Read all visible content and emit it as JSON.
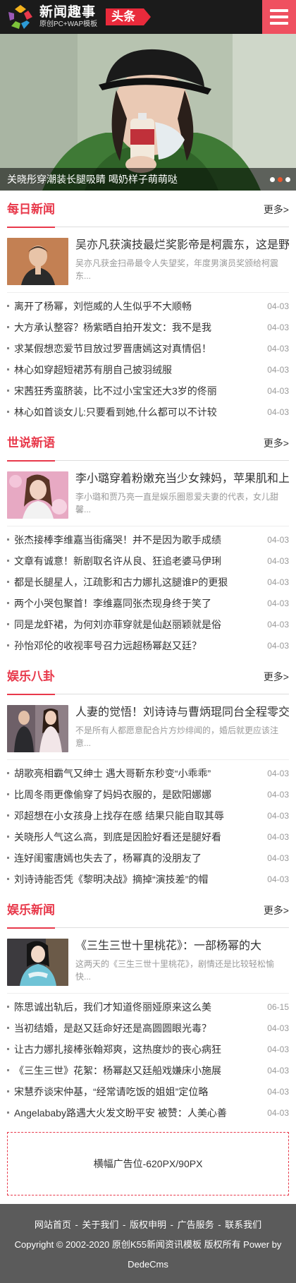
{
  "header": {
    "logo_title": "新闻趣事",
    "logo_sub": "原创PC+WAP模板",
    "badge": "头条"
  },
  "banner": {
    "caption": "关晓彤穿潮装长腿吸睛 喝奶样子萌萌哒",
    "slide_count": 3,
    "active_slide": 1
  },
  "sections": [
    {
      "title": "每日新闻",
      "more": "更多>",
      "feature": {
        "title": "吴亦凡获演技最烂奖影帝是柯震东，这是野",
        "desc": "吴亦凡获金扫帚最令人失望奖，年度男演员奖颁给柯震东..."
      },
      "items": [
        {
          "title": "离开了杨幂，刘恺威的人生似乎不大顺畅",
          "date": "04-03"
        },
        {
          "title": "大方承认整容？杨紫晒自拍开发文：我不是我",
          "date": "04-03"
        },
        {
          "title": "求某假想恋爱节目放过罗晋唐嫣这对真情侣！",
          "date": "04-03"
        },
        {
          "title": "林心如穿超短裙苏有朋自己披羽绒服",
          "date": "04-03"
        },
        {
          "title": "宋茜狂秀蛮脐装，比不过小宝宝还大3岁的佟丽",
          "date": "04-03"
        },
        {
          "title": "林心如首谈女儿:只要看到她,什么都可以不计较",
          "date": "04-03"
        }
      ]
    },
    {
      "title": "世说新语",
      "more": "更多>",
      "feature": {
        "title": "李小璐穿着粉嫩充当少女辣妈，苹果肌和上",
        "desc": "李小璐和贾乃亮一直是娱乐圈恩爱夫妻的代表，女儿甜馨..."
      },
      "items": [
        {
          "title": "张杰接棒李维嘉当街痛哭！并不是因为歌手成绩",
          "date": "04-03"
        },
        {
          "title": "文章有诚意！新剧取名许从良、狂追老婆马伊琍",
          "date": "04-03"
        },
        {
          "title": "都是长腿星人，江疏影和古力娜扎这腿谁P的更狠",
          "date": "04-03"
        },
        {
          "title": "两个小哭包聚首！李维嘉同张杰现身终于笑了",
          "date": "04-03"
        },
        {
          "title": "同是龙虾裙，为何刘亦菲穿就是仙赵丽颖就是俗",
          "date": "04-03"
        },
        {
          "title": "孙怡邓伦的收视率号召力远超杨幂赵又廷？",
          "date": "04-03"
        }
      ]
    },
    {
      "title": "娱乐八卦",
      "more": "更多>",
      "feature": {
        "title": "人妻的觉悟！刘诗诗与曹炳琨同台全程零交",
        "desc": "不是所有人都愿意配合片方炒绯闻的，婚后就更应该注意..."
      },
      "items": [
        {
          "title": "胡歌亮相霸气又绅士 遇大哥靳东秒变“小乖乖”",
          "date": "04-03"
        },
        {
          "title": "比周冬雨更像偷穿了妈妈衣服的，是欧阳娜娜",
          "date": "04-03"
        },
        {
          "title": "邓超想在小女孩身上找存在感 结果只能自取其辱",
          "date": "04-03"
        },
        {
          "title": "关晓彤人气这么高，到底是因脸好看还是腿好看",
          "date": "04-03"
        },
        {
          "title": "连好闺蜜唐嫣也失去了，杨幂真的没朋友了",
          "date": "04-03"
        },
        {
          "title": "刘诗诗能否凭《黎明决战》摘掉“演技差”的帽",
          "date": "04-03"
        }
      ]
    },
    {
      "title": "娱乐新闻",
      "more": "更多>",
      "feature": {
        "title": "《三生三世十里桃花》：一部杨幂的大",
        "desc": "这两天的《三生三世十里桃花》，剧情还是比较轻松愉快..."
      },
      "items": [
        {
          "title": "陈思诚出轨后，我们才知道佟丽娅原来这么美",
          "date": "06-15"
        },
        {
          "title": "当初结婚，是赵又廷命好还是高圆圆眼光毒？",
          "date": "04-03"
        },
        {
          "title": "让古力娜扎接棒张翰郑爽，这热度炒的丧心病狂",
          "date": "04-03"
        },
        {
          "title": "《三生三世》花絮：杨幂赵又廷船戏嫌床小施展",
          "date": "04-03"
        },
        {
          "title": "宋慧乔谈宋仲基，“经常请吃饭的姐姐”定位略",
          "date": "04-03"
        },
        {
          "title": "Angelababy路遇大火发文盼平安 被赞：人美心善",
          "date": "04-03"
        }
      ]
    }
  ],
  "ad": {
    "text": "横幅广告位-620PX/90PX"
  },
  "footer": {
    "links": [
      "网站首页",
      "关于我们",
      "版权申明",
      "广告服务",
      "联系我们"
    ],
    "separator": " - ",
    "copyright": "Copyright © 2002-2020 原创K55新闻资讯模板 版权所有 Power by DedeCms"
  },
  "colors": {
    "accent": "#e8394b",
    "header_bg": "#1b1b1b",
    "menu_bg": "#ef5060",
    "footer_bg": "#5b5b5b"
  }
}
